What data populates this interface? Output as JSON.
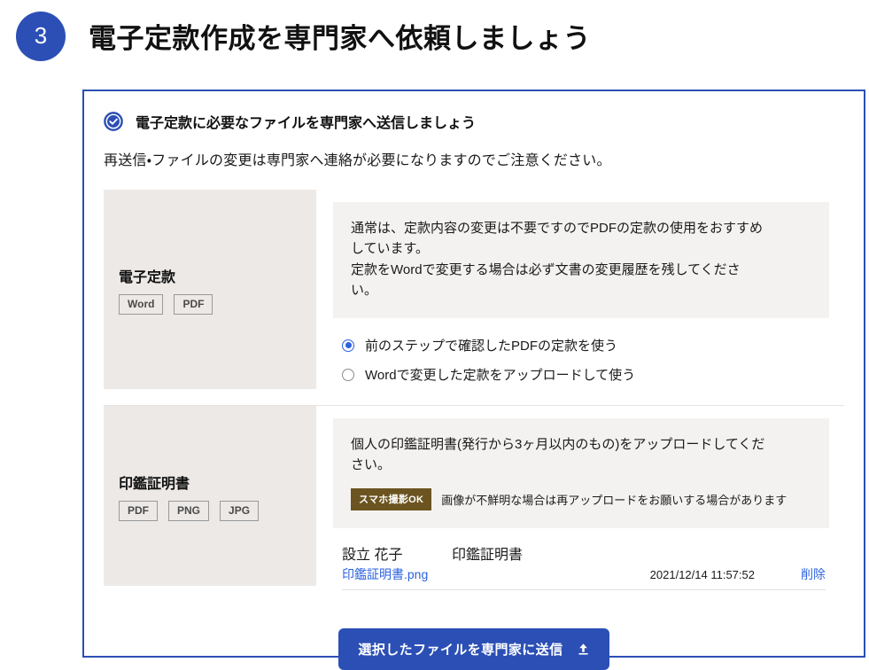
{
  "page": {
    "step_number": "3",
    "title": "電子定款作成を専門家へ依頼しましょう"
  },
  "card": {
    "heading": "電子定款に必要なファイルを専門家へ送信しましょう",
    "heading_icon": "check-circle-icon",
    "subtext": "再送信・ファイルの変更は専門家へ連絡が必要になりますのでご注意ください。",
    "border_color": "#2b4fb5"
  },
  "rows": [
    {
      "label": "電子定款",
      "chips": [
        "Word",
        "PDF"
      ],
      "note_lines": [
        "通常は、定款内容の変更は不要ですのでPDFの定款の使用をおすすめ",
        "しています。",
        "定款をWordで変更する場合は必ず文書の変更履歴を残してくださ",
        "い。"
      ],
      "options": [
        {
          "label": "前のステップで確認したPDFの定款を使う",
          "selected": true
        },
        {
          "label": "Wordで変更した定款をアップロードして使う",
          "selected": false
        }
      ]
    },
    {
      "label": "印鑑証明書",
      "chips": [
        "PDF",
        "PNG",
        "JPG"
      ],
      "note_lines": [
        "個人の印鑑証明書(発行から3ヶ月以内のもの)をアップロードしてくだ",
        "さい。"
      ],
      "badge": "スマホ撮影OK",
      "badge_color": "#6b5420",
      "badge_note": "画像が不鮮明な場合は再アップロードをお願いする場合があります",
      "file": {
        "owner": "設立 花子",
        "kind": "印鑑証明書",
        "name": "印鑑証明書.png",
        "date": "2021/12/14 11:57:52",
        "delete_label": "削除",
        "link_color": "#2b62e0"
      }
    }
  ],
  "submit": {
    "label": "選択したファイルを専門家に送信",
    "icon": "upload-icon",
    "color": "#2b4fb5"
  }
}
